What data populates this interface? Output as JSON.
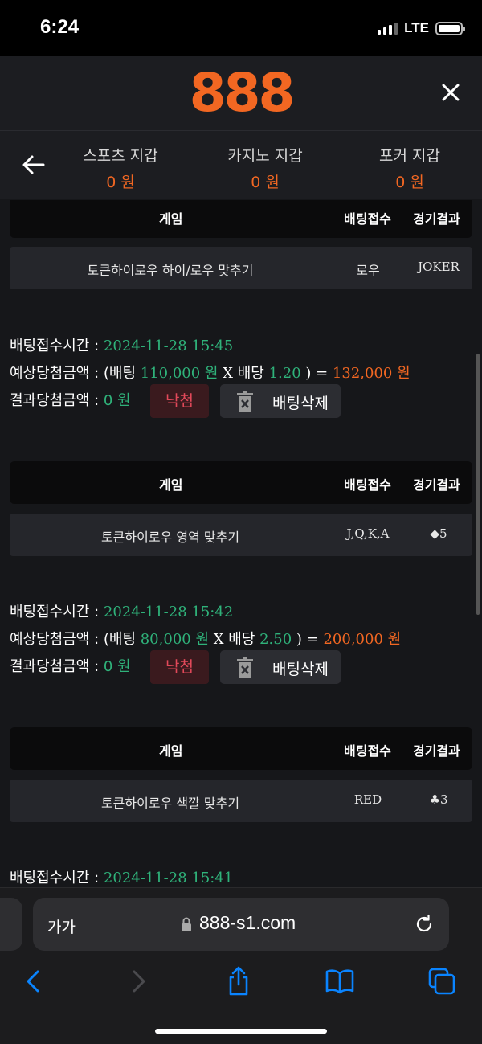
{
  "status_bar": {
    "time": "6:24",
    "network": "LTE"
  },
  "header": {
    "logo": "888"
  },
  "wallets": [
    {
      "label": "스포츠 지갑",
      "amount": "0 원"
    },
    {
      "label": "카지노 지갑",
      "amount": "0 원"
    },
    {
      "label": "포커 지갑",
      "amount": "0 원"
    }
  ],
  "table_headers": {
    "game": "게임",
    "bet": "배팅접수",
    "result": "경기결과"
  },
  "bets": [
    {
      "game": "토큰하이로우 하이/로우 맞추기",
      "pick": "로우",
      "result": "JOKER",
      "time_label": "배팅접수시간 : ",
      "time": "2024-11-28 15:45",
      "expected_label": "예상당첨금액 : (배팅 ",
      "bet_amount": "110,000 원",
      "x_odds": " X 배당 ",
      "odds": "1.20",
      "eq": " ) = ",
      "payout": "132,000 원",
      "result_label": "결과당첨금액 : ",
      "result_amount": "0 원",
      "status": "낙첨",
      "delete_label": "배팅삭제"
    },
    {
      "game": "토큰하이로우 영역 맞추기",
      "pick": "J,Q,K,A",
      "result": "◆5",
      "time_label": "배팅접수시간 : ",
      "time": "2024-11-28 15:42",
      "expected_label": "예상당첨금액 : (배팅 ",
      "bet_amount": "80,000 원",
      "x_odds": " X 배당 ",
      "odds": "2.50",
      "eq": " ) = ",
      "payout": "200,000 원",
      "result_label": "결과당첨금액 : ",
      "result_amount": "0 원",
      "status": "낙첨",
      "delete_label": "배팅삭제"
    },
    {
      "game": "토큰하이로우 색깔 맞추기",
      "pick": "RED",
      "result": "♣3",
      "time_label": "배팅접수시간 : ",
      "time": "2024-11-28 15:41"
    }
  ],
  "browser": {
    "aa": "가가",
    "url": "888-s1.com"
  },
  "colors": {
    "accent": "#f26722",
    "green": "#2fb27a",
    "lose": "#e2495a",
    "ios_blue": "#0a84ff"
  }
}
